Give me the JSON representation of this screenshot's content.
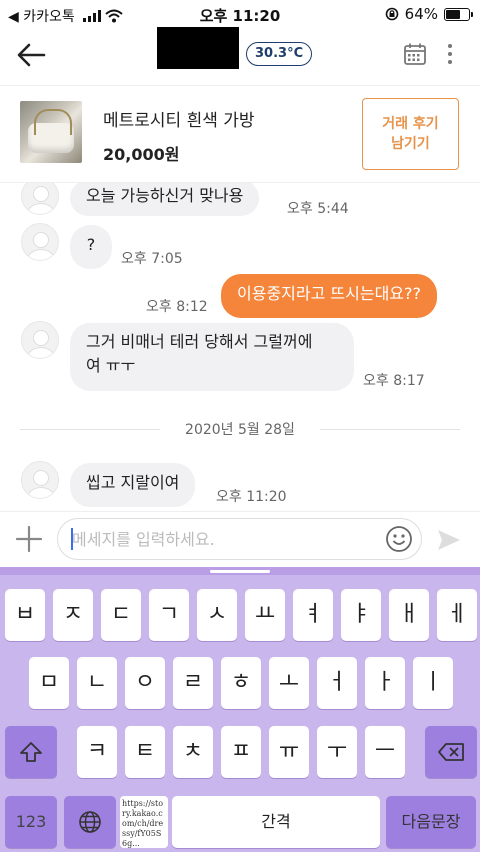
{
  "status_bar": {
    "back_app": "◀ 카카오톡",
    "time": "오후 11:20",
    "battery": "64%",
    "battery_level": 0.64
  },
  "header": {
    "temperature": "30.3°C",
    "icons": [
      "back-arrow-icon",
      "calendar-icon",
      "more-vertical-icon"
    ]
  },
  "product": {
    "title": "메트로시티 흰색 가방",
    "price": "20,000원",
    "review_button": [
      "거래 후기",
      "남기기"
    ]
  },
  "messages": [
    {
      "side": "them",
      "text": "오늘 가능하신거 맞나용",
      "time": "오후 5:44"
    },
    {
      "side": "them",
      "text": "?",
      "time": "오후 7:05"
    },
    {
      "side": "me",
      "text": "이용중지라고 뜨시는대요??",
      "time": "오후 8:12"
    },
    {
      "side": "them",
      "lines": [
        "그거 비매너 테러 당해서 그럴꺼에",
        "여 ㅠㅜ"
      ],
      "time": "오후 8:17"
    },
    {
      "side": "date",
      "text": "2020년 5월 28일"
    },
    {
      "side": "them",
      "text": "씹고 지랄이여",
      "time": "오후 11:20"
    }
  ],
  "input": {
    "placeholder": "메세지를 입력하세요.",
    "value": ""
  },
  "keyboard": {
    "row1": [
      "ㅂ",
      "ㅈ",
      "ㄷ",
      "ㄱ",
      "ㅅ",
      "ㅛ",
      "ㅕ",
      "ㅑ",
      "ㅐ",
      "ㅔ"
    ],
    "row2": [
      "ㅁ",
      "ㄴ",
      "ㅇ",
      "ㄹ",
      "ㅎ",
      "ㅗ",
      "ㅓ",
      "ㅏ",
      "ㅣ"
    ],
    "row3": [
      "ㅋ",
      "ㅌ",
      "ㅊ",
      "ㅍ",
      "ㅠ",
      "ㅜ",
      "ㅡ"
    ],
    "numbers_key": "123",
    "space_key": "간격",
    "return_key": "다음문장",
    "url_text": "https://story.kakao.com/ch/dressy/fY05S6g..."
  },
  "colors": {
    "accent": "#f4853a",
    "temperature": "#1f3e6b",
    "keyboard_bg": "#c9b6ec",
    "keyboard_func": "#9d7fe0"
  }
}
